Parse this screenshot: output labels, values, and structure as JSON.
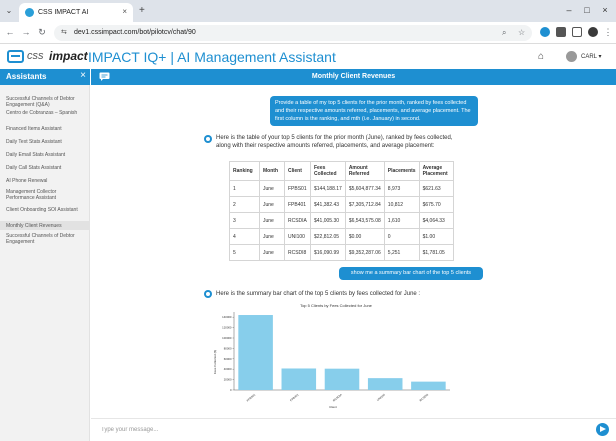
{
  "browser": {
    "tab_title": "CSS IMPACT AI",
    "tab_close": "×",
    "new_tab": "+",
    "url": "dev1.cssimpact.com/bot/pilotcv/chat/90",
    "window_controls": [
      "–",
      "□",
      "×"
    ]
  },
  "app": {
    "logo_prefix": "css",
    "logo_brand": "impact",
    "title": "IMPACT IQ+ | AI Management Assistant",
    "user_name": "CARL ▾"
  },
  "sidebar": {
    "title": "Assistants",
    "close_label": "×",
    "items": [
      {
        "label": "Successful Channels of Debtor Engagement (Q&A)"
      },
      {
        "label": "Centro de Cobranzas – Spanish"
      },
      {
        "label": "Financed Items Assistant"
      },
      {
        "label": "Daily Text Stats Assistant"
      },
      {
        "label": "Daily Email Stats Assistant"
      },
      {
        "label": "Daily Call Stats Assistant"
      },
      {
        "label": "AI Phone Renewal"
      },
      {
        "label": "Management Collector Performance Assistant"
      },
      {
        "label": "Client Onboarding SOI Assistant"
      },
      {
        "label": "Monthly Client Revenues"
      },
      {
        "label": "Successful Channels of Debtor Engagement"
      }
    ]
  },
  "chat": {
    "header_title": "Monthly Client Revenues",
    "user_message_1": "Provide a table of my top 5 clients for the prior month, ranked by fees collected and their respective amounts referred, placements, and average placement. The first column is the ranking, and mth (i.e. January) in second.",
    "bot_message_1": "Here is the table of your top 5 clients for the prior month (June), ranked by fees collected, along with their respective amounts referred, placements, and average placement:",
    "table": {
      "headers": [
        "Ranking",
        "Month",
        "Client",
        "Fees Collected",
        "Amount Referred",
        "Placements",
        "Average Placement"
      ],
      "rows": [
        [
          "1",
          "June",
          "FPBS01",
          "$144,188.17",
          "$5,604,877.34",
          "8,973",
          "$621.63"
        ],
        [
          "2",
          "June",
          "FPB401",
          "$41,382.43",
          "$7,305,712.84",
          "10,812",
          "$675.70"
        ],
        [
          "3",
          "June",
          "RCSDIA",
          "$41,005.30",
          "$6,543,575.08",
          "1,610",
          "$4,064.33"
        ],
        [
          "4",
          "June",
          "UNI100",
          "$22,812.05",
          "$0.00",
          "0",
          "$1.00"
        ],
        [
          "5",
          "June",
          "RCSDI8",
          "$16,090.99",
          "$9,352,287.06",
          "5,251",
          "$1,781.05"
        ]
      ]
    },
    "user_message_2": "show me a summary bar chart of the top 5 clients",
    "bot_message_2": "Here is the summary bar chart of the top 5 clients by fees collected for June :",
    "input_placeholder": "Type your message..."
  },
  "chart_data": {
    "type": "bar",
    "title": "Top 5 Clients by Fees Collected for June",
    "xlabel": "Client",
    "ylabel": "Fees Collected ($)",
    "categories": [
      "FPBS01",
      "FPB401",
      "RCSDIA",
      "UNI100",
      "RCSDI8"
    ],
    "values": [
      144188.17,
      41382.43,
      41005.3,
      22812.05,
      16090.99
    ],
    "ylim": [
      0,
      150000
    ],
    "yticks": [
      0,
      20000,
      40000,
      60000,
      80000,
      100000,
      120000,
      140000
    ],
    "color": "#87ceeb",
    "grid": false
  }
}
